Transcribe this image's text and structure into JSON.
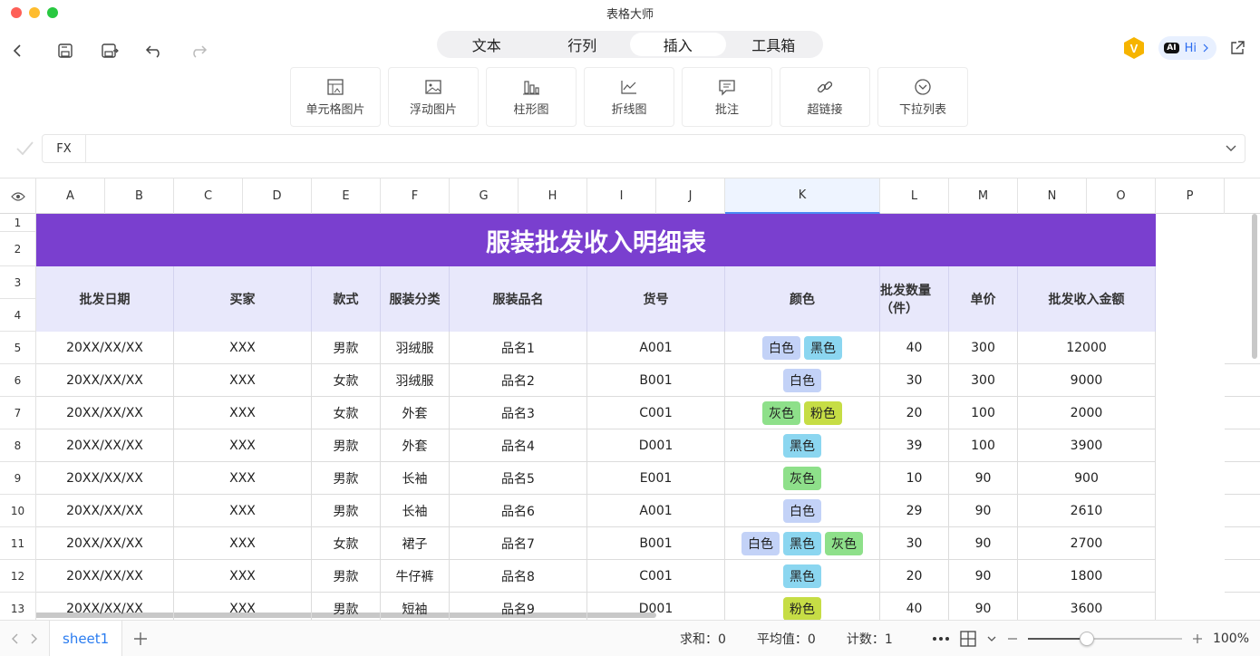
{
  "app": {
    "title": "表格大师"
  },
  "tabs": [
    {
      "label": "文本",
      "active": false
    },
    {
      "label": "行列",
      "active": false
    },
    {
      "label": "插入",
      "active": true
    },
    {
      "label": "工具箱",
      "active": false
    }
  ],
  "ai": {
    "badge": "AI",
    "label": "Hi"
  },
  "ribbon": [
    {
      "label": "单元格图片",
      "icon": "cell-image-icon"
    },
    {
      "label": "浮动图片",
      "icon": "image-icon"
    },
    {
      "label": "柱形图",
      "icon": "bar-chart-icon"
    },
    {
      "label": "折线图",
      "icon": "line-chart-icon"
    },
    {
      "label": "批注",
      "icon": "comment-icon"
    },
    {
      "label": "超链接",
      "icon": "link-icon"
    },
    {
      "label": "下拉列表",
      "icon": "dropdown-icon"
    }
  ],
  "formula": {
    "label": "FX",
    "value": ""
  },
  "columns": [
    "A",
    "B",
    "C",
    "D",
    "E",
    "F",
    "G",
    "H",
    "I",
    "J",
    "K",
    "L",
    "M",
    "N",
    "O",
    "P"
  ],
  "selected_column": "K",
  "row_numbers": [
    "1",
    "2",
    "3",
    "4",
    "5",
    "6",
    "7",
    "8",
    "9",
    "10",
    "11",
    "12",
    "13"
  ],
  "sheet_title": "服装批发收入明细表",
  "headers": [
    "批发日期",
    "买家",
    "款式",
    "服装分类",
    "服装品名",
    "货号",
    "颜色",
    "批发数量（件）",
    "单价",
    "批发收入金额"
  ],
  "tag_colors": {
    "白色": "#c3d2f7",
    "黑色": "#8bd6f0",
    "灰色": "#8ee08a",
    "粉色": "#c6dd45"
  },
  "rows": [
    {
      "date": "20XX/XX/XX",
      "buyer": "XXX",
      "style": "男款",
      "category": "羽绒服",
      "name": "品名1",
      "code": "A001",
      "colors": [
        "白色",
        "黑色"
      ],
      "qty": "40",
      "price": "300",
      "amount": "12000"
    },
    {
      "date": "20XX/XX/XX",
      "buyer": "XXX",
      "style": "女款",
      "category": "羽绒服",
      "name": "品名2",
      "code": "B001",
      "colors": [
        "白色"
      ],
      "qty": "30",
      "price": "300",
      "amount": "9000"
    },
    {
      "date": "20XX/XX/XX",
      "buyer": "XXX",
      "style": "女款",
      "category": "外套",
      "name": "品名3",
      "code": "C001",
      "colors": [
        "灰色",
        "粉色"
      ],
      "qty": "20",
      "price": "100",
      "amount": "2000"
    },
    {
      "date": "20XX/XX/XX",
      "buyer": "XXX",
      "style": "男款",
      "category": "外套",
      "name": "品名4",
      "code": "D001",
      "colors": [
        "黑色"
      ],
      "qty": "39",
      "price": "100",
      "amount": "3900"
    },
    {
      "date": "20XX/XX/XX",
      "buyer": "XXX",
      "style": "男款",
      "category": "长袖",
      "name": "品名5",
      "code": "E001",
      "colors": [
        "灰色"
      ],
      "qty": "10",
      "price": "90",
      "amount": "900"
    },
    {
      "date": "20XX/XX/XX",
      "buyer": "XXX",
      "style": "男款",
      "category": "长袖",
      "name": "品名6",
      "code": "A001",
      "colors": [
        "白色"
      ],
      "qty": "29",
      "price": "90",
      "amount": "2610"
    },
    {
      "date": "20XX/XX/XX",
      "buyer": "XXX",
      "style": "女款",
      "category": "裙子",
      "name": "品名7",
      "code": "B001",
      "colors": [
        "白色",
        "黑色",
        "灰色"
      ],
      "qty": "30",
      "price": "90",
      "amount": "2700"
    },
    {
      "date": "20XX/XX/XX",
      "buyer": "XXX",
      "style": "男款",
      "category": "牛仔裤",
      "name": "品名8",
      "code": "C001",
      "colors": [
        "黑色"
      ],
      "qty": "20",
      "price": "90",
      "amount": "1800"
    },
    {
      "date": "20XX/XX/XX",
      "buyer": "XXX",
      "style": "男款",
      "category": "短袖",
      "name": "品名9",
      "code": "D001",
      "colors": [
        "粉色"
      ],
      "qty": "40",
      "price": "90",
      "amount": "3600"
    }
  ],
  "bottom": {
    "sheet_name": "sheet1",
    "sum_label": "求和：",
    "sum_value": "0",
    "avg_label": "平均值：",
    "avg_value": "0",
    "count_label": "计数：",
    "count_value": "1",
    "zoom": "100%",
    "zoom_level": 0.38
  },
  "theme": {
    "title_band": "#7a3fcf",
    "header_band": "#e8e8fb",
    "accent": "#4a8af4"
  }
}
